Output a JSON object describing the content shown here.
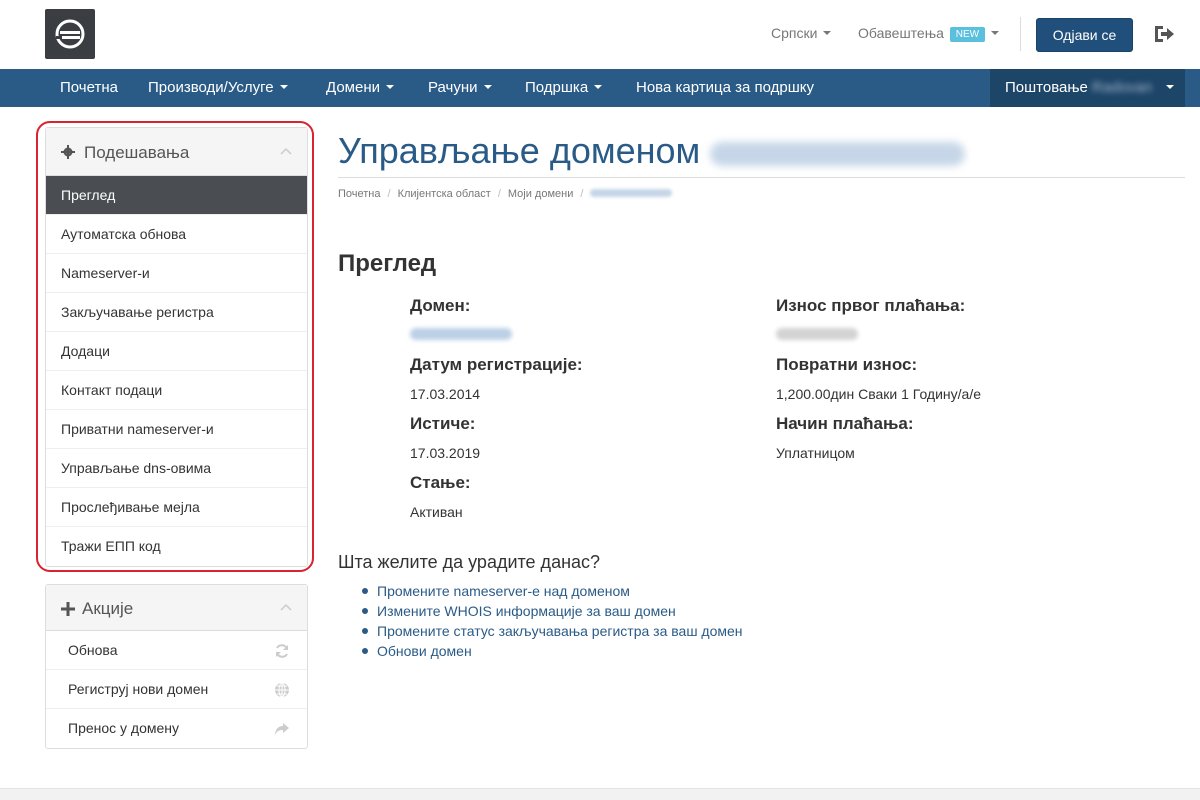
{
  "header": {
    "logo_icon": "brand-logo-icon",
    "language": "Српски",
    "notifications": "Обавештења",
    "new_badge": "NEW",
    "logout_button": "Одјави се",
    "logout_icon": "sign-out-icon"
  },
  "nav": {
    "items": [
      "Почетна",
      "Производи/Услуге",
      "Домени",
      "Рачуни",
      "Подршка",
      "Нова картица за подршку"
    ],
    "greeting": "Поштовање",
    "username": "Radovan"
  },
  "sidebar": {
    "settings_title": "Подешавања",
    "settings_items": [
      "Преглед",
      "Аутоматска обнова",
      "Nameserver-и",
      "Закључавање регистра",
      "Додаци",
      "Контакт подаци",
      "Приватни nameserver-и",
      "Управљање dns-овима",
      "Прослеђивање мејла",
      "Тражи ЕПП код"
    ],
    "actions_title": "Акције",
    "actions_items": [
      "Обнова",
      "Региструј нови домен",
      "Пренос у домену"
    ]
  },
  "main": {
    "title": "Управљање доменом",
    "breadcrumb": [
      "Почетна",
      "Клијентска област",
      "Моји домени"
    ],
    "section_title": "Преглед",
    "labels": {
      "domain": "Домен:",
      "reg_date": "Датум регистрације:",
      "expires": "Истиче:",
      "status": "Стање:",
      "first_payment": "Износ првог плаћања:",
      "recurring": "Повратни износ:",
      "payment_method": "Начин плаћања:"
    },
    "values": {
      "reg_date": "17.03.2014",
      "expires": "17.03.2019",
      "status": "Активан",
      "recurring": "1,200.00дин Сваки 1 Годину/а/е",
      "payment_method": "Уплатницом"
    },
    "todo_title": "Шта желите да урадите данас?",
    "todo_links": [
      "Промените nameserver-е над доменом",
      "Измените WHOIS информације за ваш домен",
      "Промените статус закључавања регистра за ваш домен",
      "Обнови домен"
    ]
  },
  "colors": {
    "nav_bg": "#2a5b87",
    "accent": "#1f4f7a",
    "active_item": "#4a4e53",
    "highlight": "#d9232e"
  }
}
